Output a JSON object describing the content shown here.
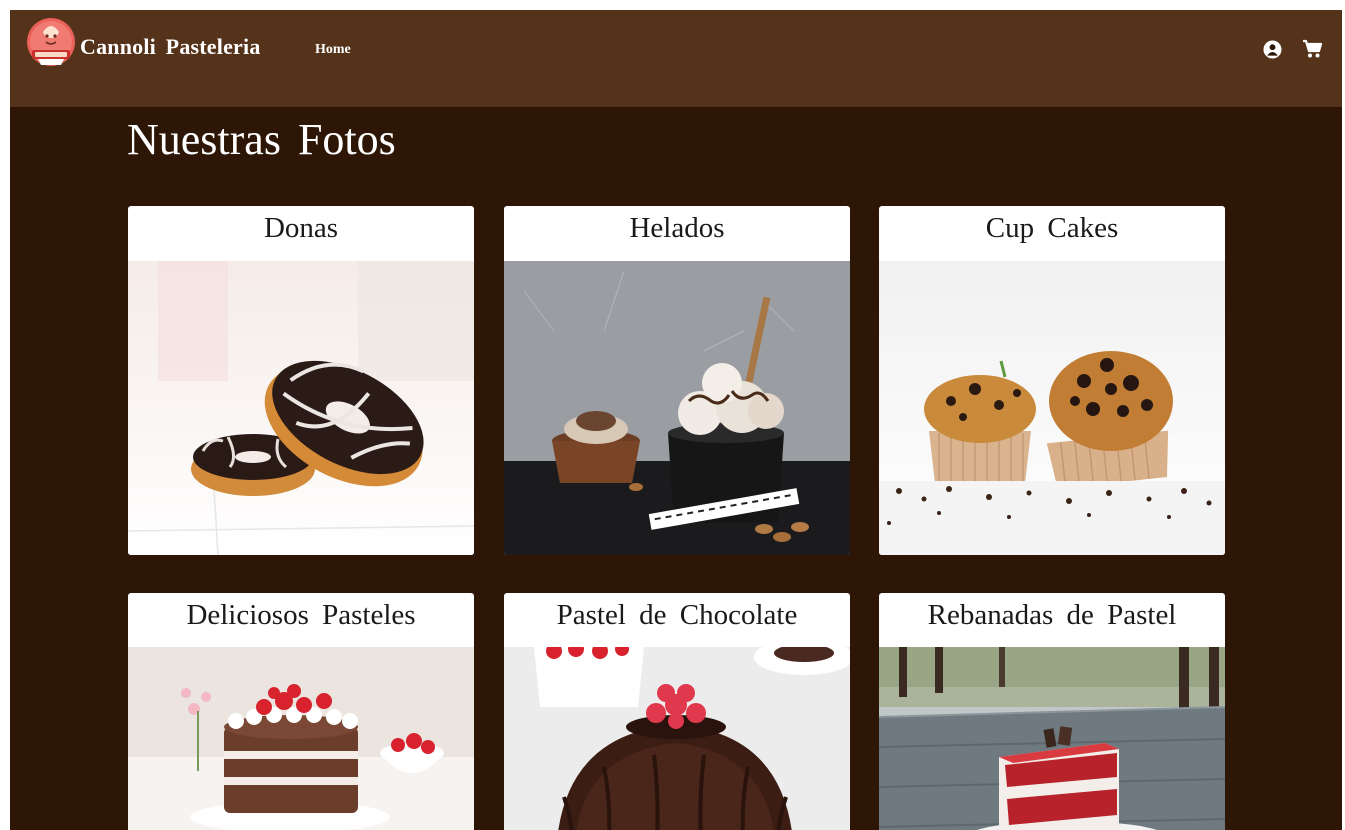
{
  "header": {
    "brand": "Cannoli Pasteleria",
    "nav": [
      "Home"
    ],
    "icons": [
      "logo-icon",
      "user-icon",
      "cart-icon"
    ]
  },
  "colors": {
    "navbar": "#55331a",
    "page_background": "#2d1606",
    "card_background": "#ffffff",
    "title_text": "#ffffff"
  },
  "main": {
    "title": "Nuestras Fotos",
    "gallery": [
      {
        "label": "Donas",
        "photo": "donuts-photo"
      },
      {
        "label": "Helados",
        "photo": "ice-cream-photo"
      },
      {
        "label": "Cup Cakes",
        "photo": "cupcakes-photo"
      },
      {
        "label": "Deliciosos Pasteles",
        "photo": "strawberry-cake-photo"
      },
      {
        "label": "Pastel de Chocolate",
        "photo": "chocolate-cake-photo"
      },
      {
        "label": "Rebanadas de Pastel",
        "photo": "cake-slice-photo"
      }
    ]
  }
}
